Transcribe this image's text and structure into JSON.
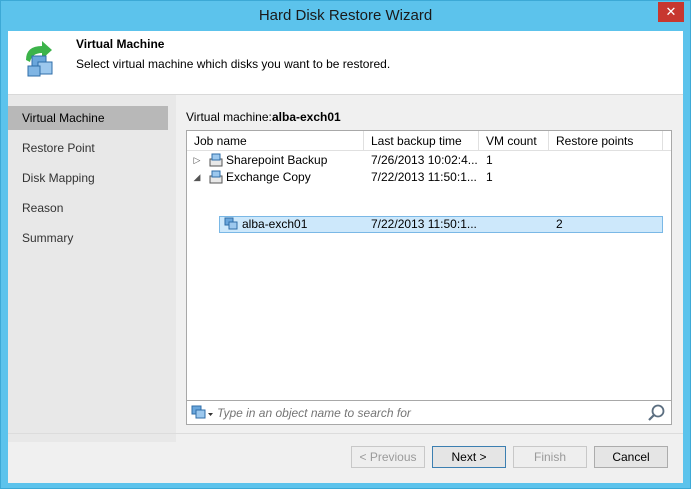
{
  "window": {
    "title": "Hard Disk Restore Wizard",
    "close_glyph": "✕"
  },
  "header": {
    "title": "Virtual Machine",
    "description": "Select virtual machine which disks you want to be restored.",
    "icon": "vm-restore-icon"
  },
  "nav": {
    "items": [
      {
        "label": "Virtual Machine",
        "active": true
      },
      {
        "label": "Restore Point",
        "active": false
      },
      {
        "label": "Disk Mapping",
        "active": false
      },
      {
        "label": "Reason",
        "active": false
      },
      {
        "label": "Summary",
        "active": false
      }
    ]
  },
  "vm": {
    "label": "Virtual machine:",
    "value": "alba-exch01"
  },
  "grid": {
    "columns": [
      "Job name",
      "Last backup time",
      "VM count",
      "Restore points"
    ],
    "rows": [
      {
        "name": "Sharepoint Backup",
        "last_backup": "7/26/2013 10:02:4...",
        "vm_count": "1",
        "restore_points": "",
        "expander": "▷",
        "icon": "backup-job-icon",
        "selected": false
      },
      {
        "name": "Exchange Copy",
        "last_backup": "7/22/2013 11:50:1...",
        "vm_count": "1",
        "restore_points": "",
        "expander": "◢",
        "icon": "backup-job-icon",
        "selected": false
      },
      {
        "name": "alba-exch01",
        "last_backup": "7/22/2013 11:50:1...",
        "vm_count": "",
        "restore_points": "2",
        "expander": "",
        "icon": "vm-icon",
        "selected": true
      }
    ]
  },
  "search": {
    "placeholder": "Type in an object name to search for",
    "value": ""
  },
  "buttons": {
    "previous": "< Previous",
    "next": "Next >",
    "finish": "Finish",
    "cancel": "Cancel"
  },
  "colors": {
    "title_bar": "#5cc3ec",
    "close": "#c7372f",
    "selection": "#cde8fb",
    "nav_active": "#b8b8b8"
  }
}
